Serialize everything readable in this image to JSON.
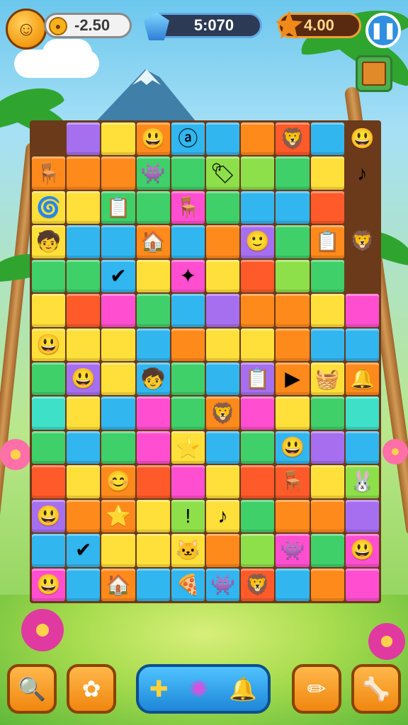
{
  "hud": {
    "coins": "-2.50",
    "gems": "5:070",
    "stars": "4.00"
  },
  "icons": {
    "avatar": "smiley-coin-icon",
    "coin": "coin-icon",
    "gem": "gem-icon",
    "star": "star-icon",
    "pause": "pause-icon",
    "crate": "crate-icon"
  },
  "board": {
    "rows": 14,
    "cols": 10,
    "cells": [
      [
        "x",
        "v",
        "y",
        "o",
        "b",
        "b",
        "o",
        "r",
        "b",
        "x"
      ],
      [
        "o",
        "o",
        "o",
        "g",
        "g",
        "l",
        "l",
        "g",
        "y",
        "x"
      ],
      [
        "y",
        "y",
        "g",
        "g",
        "p",
        "g",
        "b",
        "b",
        "r",
        "x"
      ],
      [
        "y",
        "b",
        "b",
        "o",
        "b",
        "o",
        "v",
        "g",
        "o",
        "x"
      ],
      [
        "g",
        "g",
        "b",
        "y",
        "p",
        "y",
        "r",
        "l",
        "g",
        "x"
      ],
      [
        "y",
        "r",
        "p",
        "g",
        "b",
        "v",
        "o",
        "o",
        "y",
        "p"
      ],
      [
        "y",
        "y",
        "y",
        "b",
        "o",
        "y",
        "y",
        "o",
        "b",
        "b"
      ],
      [
        "g",
        "v",
        "y",
        "b",
        "g",
        "b",
        "v",
        "o",
        "y",
        "o"
      ],
      [
        "c",
        "y",
        "b",
        "p",
        "g",
        "o",
        "p",
        "y",
        "g",
        "c"
      ],
      [
        "g",
        "b",
        "g",
        "p",
        "y",
        "b",
        "g",
        "b",
        "v",
        "b"
      ],
      [
        "r",
        "y",
        "o",
        "r",
        "p",
        "y",
        "r",
        "r",
        "y",
        "l"
      ],
      [
        "v",
        "o",
        "o",
        "y",
        "l",
        "y",
        "g",
        "o",
        "o",
        "v"
      ],
      [
        "b",
        "b",
        "y",
        "y",
        "y",
        "o",
        "l",
        "p",
        "g",
        "p"
      ],
      [
        "p",
        "b",
        "o",
        "b",
        "b",
        "b",
        "r",
        "b",
        "o",
        "p"
      ]
    ],
    "tokens": [
      {
        "r": 0,
        "c": 3,
        "glyph": "😃"
      },
      {
        "r": 0,
        "c": 4,
        "glyph": "ⓐ"
      },
      {
        "r": 0,
        "c": 7,
        "glyph": "🦁"
      },
      {
        "r": 0,
        "c": 9,
        "glyph": "😃"
      },
      {
        "r": 1,
        "c": 0,
        "glyph": "🪑"
      },
      {
        "r": 1,
        "c": 3,
        "glyph": "👾"
      },
      {
        "r": 1,
        "c": 5,
        "glyph": "🏷"
      },
      {
        "r": 1,
        "c": 9,
        "glyph": "♪"
      },
      {
        "r": 2,
        "c": 0,
        "glyph": "🌀"
      },
      {
        "r": 2,
        "c": 2,
        "glyph": "📋"
      },
      {
        "r": 2,
        "c": 4,
        "glyph": "🪑"
      },
      {
        "r": 3,
        "c": 0,
        "glyph": "🧒"
      },
      {
        "r": 3,
        "c": 3,
        "glyph": "🏠"
      },
      {
        "r": 3,
        "c": 6,
        "glyph": "🙂"
      },
      {
        "r": 3,
        "c": 8,
        "glyph": "📋"
      },
      {
        "r": 3,
        "c": 9,
        "glyph": "🦁"
      },
      {
        "r": 4,
        "c": 2,
        "glyph": "✔"
      },
      {
        "r": 4,
        "c": 4,
        "glyph": "✦"
      },
      {
        "r": 6,
        "c": 0,
        "glyph": "😃"
      },
      {
        "r": 7,
        "c": 1,
        "glyph": "😃"
      },
      {
        "r": 7,
        "c": 3,
        "glyph": "🧒"
      },
      {
        "r": 7,
        "c": 6,
        "glyph": "📋"
      },
      {
        "r": 7,
        "c": 7,
        "glyph": "▶"
      },
      {
        "r": 7,
        "c": 8,
        "glyph": "🧺"
      },
      {
        "r": 7,
        "c": 9,
        "glyph": "🔔"
      },
      {
        "r": 8,
        "c": 5,
        "glyph": "🦁"
      },
      {
        "r": 9,
        "c": 4,
        "glyph": "⭐"
      },
      {
        "r": 9,
        "c": 7,
        "glyph": "😃"
      },
      {
        "r": 10,
        "c": 2,
        "glyph": "😊"
      },
      {
        "r": 10,
        "c": 7,
        "glyph": "🪑"
      },
      {
        "r": 10,
        "c": 9,
        "glyph": "🐰"
      },
      {
        "r": 11,
        "c": 0,
        "glyph": "😃"
      },
      {
        "r": 11,
        "c": 2,
        "glyph": "⭐"
      },
      {
        "r": 11,
        "c": 4,
        "glyph": "!"
      },
      {
        "r": 11,
        "c": 5,
        "glyph": "♪"
      },
      {
        "r": 12,
        "c": 1,
        "glyph": "✔"
      },
      {
        "r": 12,
        "c": 4,
        "glyph": "🐱"
      },
      {
        "r": 12,
        "c": 7,
        "glyph": "👾"
      },
      {
        "r": 12,
        "c": 9,
        "glyph": "😃"
      },
      {
        "r": 13,
        "c": 0,
        "glyph": "😃"
      },
      {
        "r": 13,
        "c": 2,
        "glyph": "🏠"
      },
      {
        "r": 13,
        "c": 4,
        "glyph": "🍕"
      },
      {
        "r": 13,
        "c": 5,
        "glyph": "👾"
      },
      {
        "r": 13,
        "c": 6,
        "glyph": "🦁"
      }
    ]
  },
  "toolbar": {
    "buttons": [
      {
        "name": "hint-button",
        "icon": "magnifier-icon",
        "glyph": "🔍"
      },
      {
        "name": "shuffle-button",
        "icon": "flower-icon",
        "glyph": "✿"
      },
      {
        "name": "pencil-button",
        "icon": "pencil-icon",
        "glyph": "✏"
      },
      {
        "name": "bone-button",
        "icon": "bone-icon",
        "glyph": "🦴"
      }
    ],
    "boosters": [
      {
        "name": "plus-booster",
        "icon": "plus-icon",
        "glyph": "✚"
      },
      {
        "name": "gear-booster",
        "icon": "gear-icon",
        "glyph": "✺"
      },
      {
        "name": "bell-booster",
        "icon": "bell-icon",
        "glyph": "🔔"
      }
    ]
  }
}
